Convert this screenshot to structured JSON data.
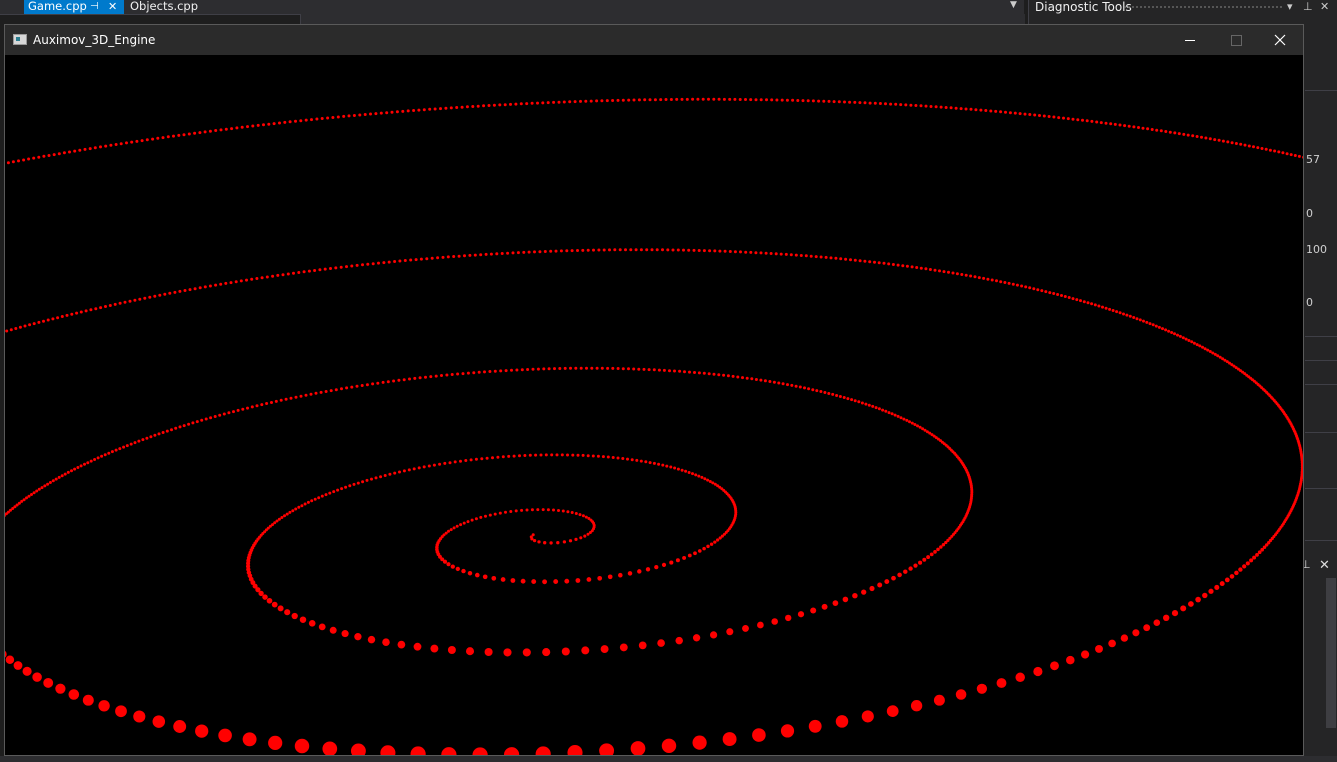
{
  "ide": {
    "tabs": [
      {
        "label": "Game.cpp",
        "active": true
      },
      {
        "label": "Objects.cpp",
        "active": false
      }
    ],
    "tab_pin_icon": "pin-icon",
    "tab_close_icon": "close-icon",
    "diagnostic": {
      "title": "Diagnostic Tools",
      "readouts": [
        "57",
        "0",
        "100",
        "0"
      ]
    }
  },
  "app_window": {
    "title": "Auximov_3D_Engine",
    "icon": "app-window-icon",
    "controls": [
      "minimize-icon",
      "maximize-icon",
      "close-icon"
    ],
    "background_color": "#000000",
    "particle_color": "#ff0000"
  }
}
